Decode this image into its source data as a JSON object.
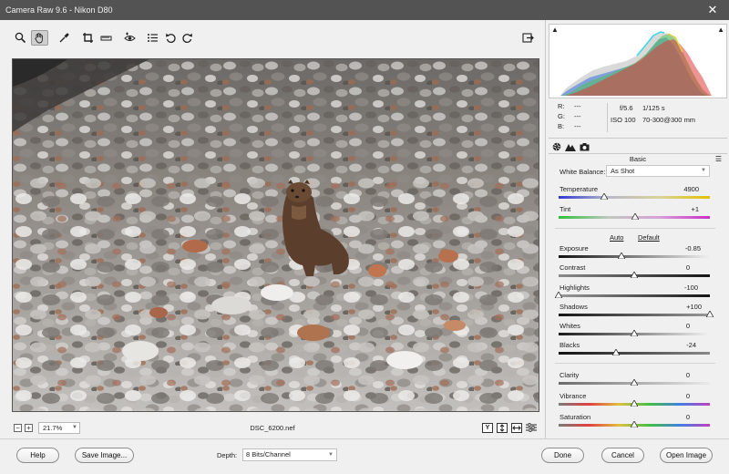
{
  "window": {
    "title": "Camera Raw 9.6  -  Nikon D80",
    "close_glyph": "✕"
  },
  "toolbar": {
    "tools": [
      {
        "name": "zoom-tool-icon",
        "active": false
      },
      {
        "name": "hand-tool-icon",
        "active": true
      },
      {
        "name": "white-balance-tool-icon",
        "active": false
      },
      {
        "name": "crop-tool-icon",
        "active": false
      },
      {
        "name": "straighten-tool-icon",
        "active": false
      },
      {
        "name": "red-eye-tool-icon",
        "active": false
      },
      {
        "name": "presets-list-icon",
        "active": false
      },
      {
        "name": "rotate-left-icon",
        "active": false
      },
      {
        "name": "rotate-right-icon",
        "active": false
      }
    ],
    "export_icon": "export-icon"
  },
  "status": {
    "zoom_out": "−",
    "zoom_in": "+",
    "zoom_value": "21.7%",
    "filename": "DSC_6200.nef",
    "view_y": "Y"
  },
  "info": {
    "r_label": "R:",
    "r_value": "---",
    "g_label": "G:",
    "g_value": "---",
    "b_label": "B:",
    "b_value": "---",
    "aperture": "f/5.6",
    "shutter": "1/125 s",
    "iso": "ISO 100",
    "lens": "70-300@300 mm"
  },
  "panel": {
    "title": "Basic",
    "white_balance_label": "White Balance:",
    "white_balance_value": "As Shot",
    "auto_label": "Auto",
    "default_label": "Default",
    "sliders": {
      "temperature": {
        "label": "Temperature",
        "value": "4900",
        "pos": 0.3
      },
      "tint": {
        "label": "Tint",
        "value": "+1",
        "pos": 0.505
      },
      "exposure": {
        "label": "Exposure",
        "value": "-0.85",
        "pos": 0.415
      },
      "contrast": {
        "label": "Contrast",
        "value": "0",
        "pos": 0.5
      },
      "highlights": {
        "label": "Highlights",
        "value": "-100",
        "pos": 0.0
      },
      "shadows": {
        "label": "Shadows",
        "value": "+100",
        "pos": 1.0
      },
      "whites": {
        "label": "Whites",
        "value": "0",
        "pos": 0.5
      },
      "blacks": {
        "label": "Blacks",
        "value": "-24",
        "pos": 0.38
      },
      "clarity": {
        "label": "Clarity",
        "value": "0",
        "pos": 0.5
      },
      "vibrance": {
        "label": "Vibrance",
        "value": "0",
        "pos": 0.5
      },
      "saturation": {
        "label": "Saturation",
        "value": "0",
        "pos": 0.5
      }
    }
  },
  "bottom": {
    "help": "Help",
    "save_image": "Save Image...",
    "depth_label": "Depth:",
    "depth_value": "8 Bits/Channel",
    "done": "Done",
    "cancel": "Cancel",
    "open_image": "Open Image"
  }
}
